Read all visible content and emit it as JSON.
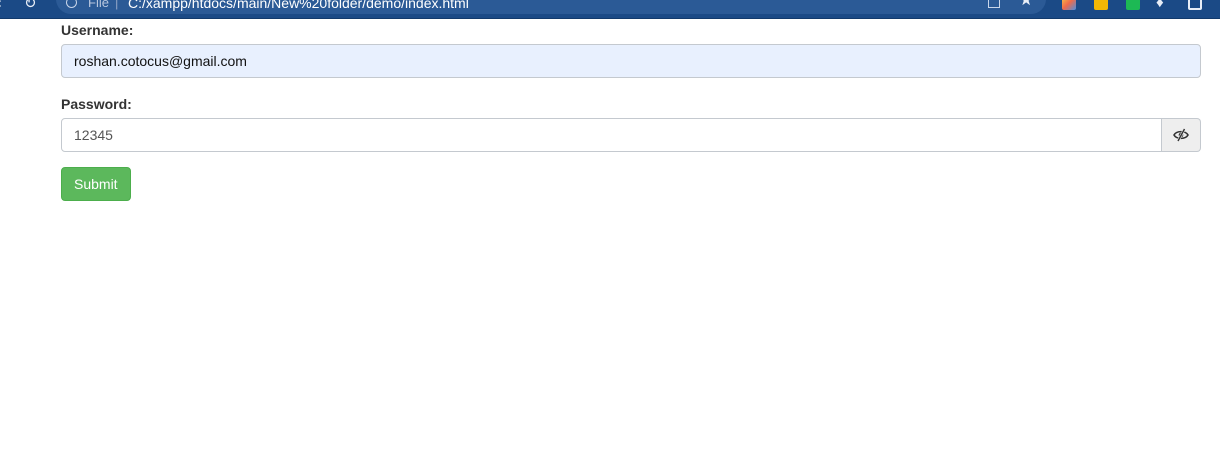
{
  "browser": {
    "scheme_label": "File",
    "url": "C:/xampp/htdocs/main/New%20folder/demo/index.html",
    "icons": [
      "back-icon",
      "reload-icon",
      "info-icon",
      "page-icon",
      "star-icon",
      "extension-icon",
      "puzzle-icon",
      "profile-icon"
    ],
    "theme_color": "#1b4a86"
  },
  "form": {
    "username_label": "Username:",
    "username_value": "roshan.cotocus@gmail.com",
    "password_label": "Password:",
    "password_value": "12345",
    "toggle_icon": "eye-slash-icon",
    "submit_label": "Submit",
    "submit_color": "#5cb85c",
    "autofill_color": "#e8f0fe"
  }
}
